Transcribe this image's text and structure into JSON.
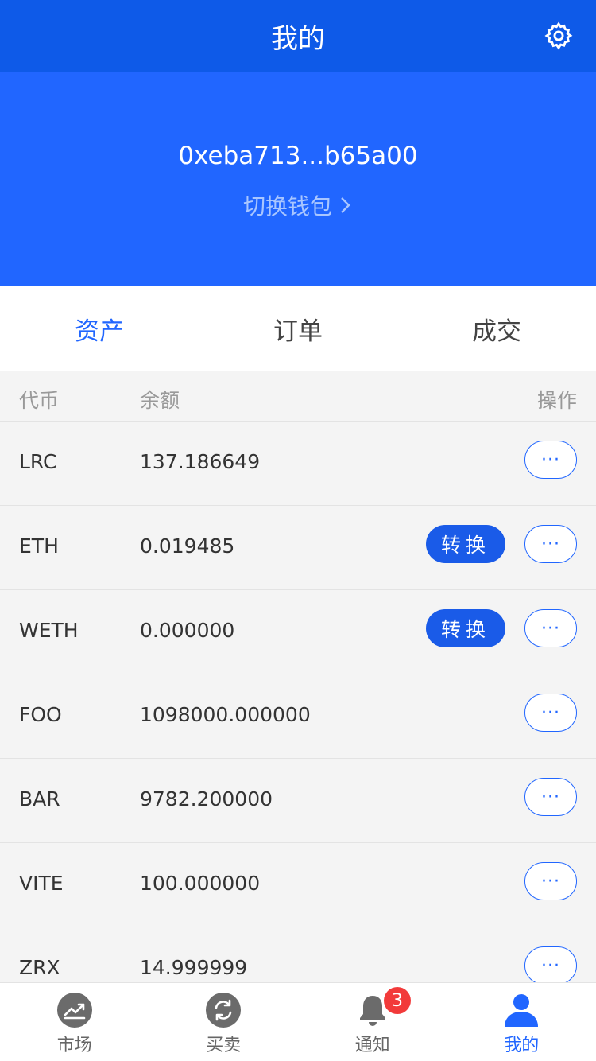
{
  "header": {
    "title": "我的",
    "settings_icon": "gear-icon"
  },
  "wallet": {
    "address": "0xeba713...b65a00",
    "switch_label": "切换钱包"
  },
  "tabs": [
    {
      "label": "资产",
      "active": true
    },
    {
      "label": "订单",
      "active": false
    },
    {
      "label": "成交",
      "active": false
    }
  ],
  "table": {
    "headers": {
      "token": "代币",
      "balance": "余额",
      "action": "操作"
    },
    "more_label": "···",
    "convert_label": "转换",
    "rows": [
      {
        "symbol": "LRC",
        "balance": "137.186649",
        "convert": false
      },
      {
        "symbol": "ETH",
        "balance": "0.019485",
        "convert": true
      },
      {
        "symbol": "WETH",
        "balance": "0.000000",
        "convert": true
      },
      {
        "symbol": "FOO",
        "balance": "1098000.000000",
        "convert": false
      },
      {
        "symbol": "BAR",
        "balance": "9782.200000",
        "convert": false
      },
      {
        "symbol": "VITE",
        "balance": "100.000000",
        "convert": false
      },
      {
        "symbol": "ZRX",
        "balance": "14.999999",
        "convert": false
      }
    ]
  },
  "tabbar": {
    "items": [
      {
        "label": "市场",
        "icon": "market-chart-icon",
        "active": false
      },
      {
        "label": "买卖",
        "icon": "exchange-icon",
        "active": false
      },
      {
        "label": "通知",
        "icon": "bell-icon",
        "active": false,
        "badge": "3"
      },
      {
        "label": "我的",
        "icon": "user-icon",
        "active": true
      }
    ]
  },
  "colors": {
    "primary": "#2166ff",
    "nav": "#0e5ae8",
    "badge": "#f23a3a"
  }
}
